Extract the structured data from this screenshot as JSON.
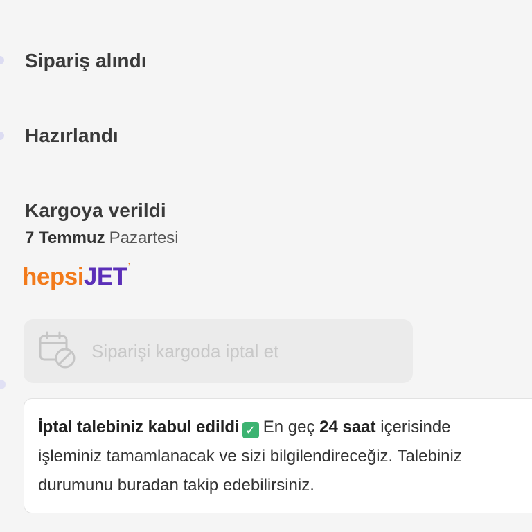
{
  "steps": [
    {
      "title": "Sipariş alındı"
    },
    {
      "title": "Hazırlandı"
    },
    {
      "title": "Kargoya verildi",
      "date": "7 Temmuz",
      "weekday": "Pazartesi"
    }
  ],
  "carrier": {
    "logo_part1": "hepsi",
    "logo_part2": "JET",
    "logo_mark": "ʼ",
    "logo_icon": "hepsijet-logo"
  },
  "cancel_button": {
    "label": "Siparişi kargoda iptal et",
    "icon": "calendar-cancel-icon"
  },
  "notice": {
    "title": "İptal talebiniz kabul edildi",
    "check_icon": "green-check-icon",
    "check_glyph": "✓",
    "t1": "En geç",
    "t2": "24 saat",
    "t3": "içerisinde",
    "line2": "işleminiz tamamlanacak ve sizi bilgilendireceğiz. Talebiniz",
    "line3": "durumunu buradan takip edebilirsiniz."
  },
  "colors": {
    "brand_orange": "#f27a1a",
    "brand_purple": "#5b2fb8",
    "success_green": "#3cb371"
  }
}
